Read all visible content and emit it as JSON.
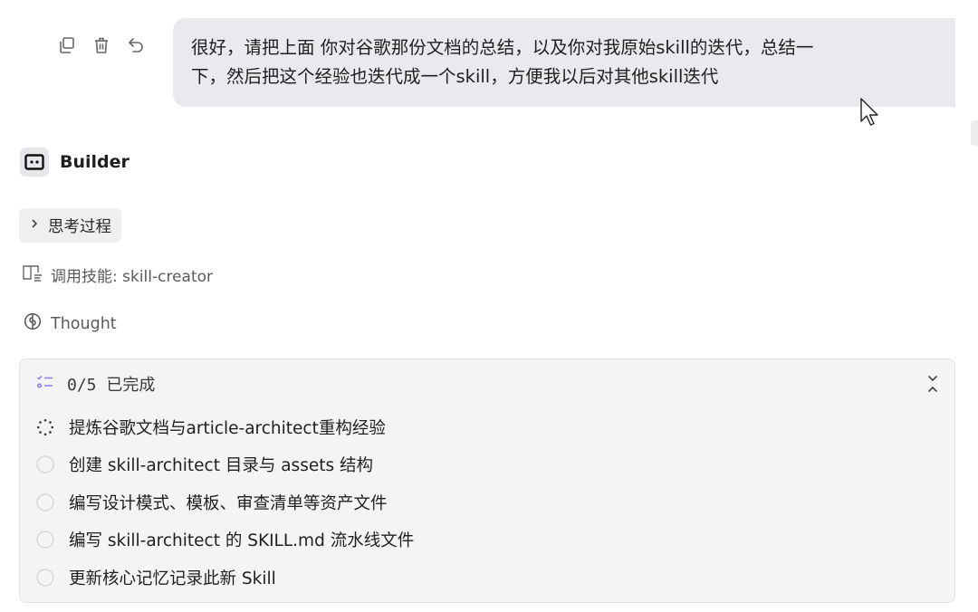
{
  "message": {
    "actions": [
      {
        "name": "copy-icon"
      },
      {
        "name": "trash-icon"
      },
      {
        "name": "undo-icon"
      }
    ],
    "text_line1": "很好，请把上面 你对谷歌那份文档的总结，以及你对我原始skill的迭代，总结一",
    "text_line2": "下，然后把这个经验也迭代成一个skill，方便我以后对其他skill迭代"
  },
  "agent": {
    "name": "Builder",
    "icon": "robot-icon"
  },
  "thinking": {
    "label": "思考过程",
    "icon": "chevron-right-icon"
  },
  "skill_call": {
    "label": "调用技能: skill-creator",
    "icon": "book-icon"
  },
  "thought": {
    "label": "Thought",
    "icon": "brain-icon"
  },
  "todo": {
    "progress": "0/5",
    "status": "已完成",
    "icon": "checklist-icon",
    "items": [
      {
        "label": "提炼谷歌文档与article-architect重构经验",
        "state": "in-progress"
      },
      {
        "label": "创建 skill-architect 目录与 assets 结构",
        "state": "pending"
      },
      {
        "label": "编写设计模式、模板、审查清单等资产文件",
        "state": "pending"
      },
      {
        "label": "编写 skill-architect 的 SKILL.md 流水线文件",
        "state": "pending"
      },
      {
        "label": "更新核心记忆记录此新 Skill",
        "state": "pending"
      }
    ]
  },
  "colors": {
    "bubble_bg": "#e9eaee",
    "panel_bg": "#f3f4f6",
    "accent_purple": "#8b7cf6"
  }
}
